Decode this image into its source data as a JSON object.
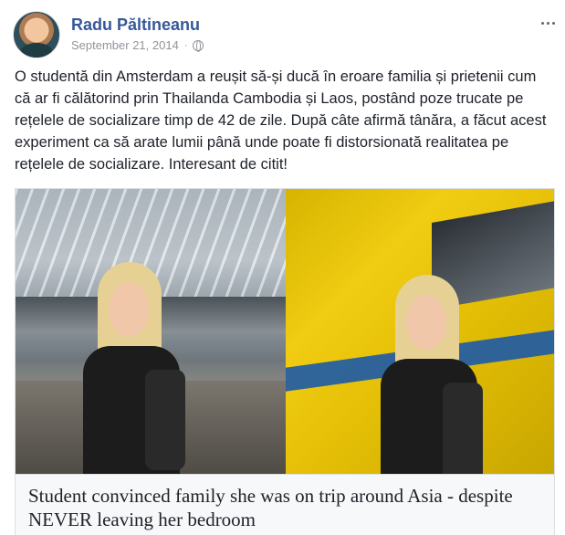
{
  "post": {
    "author": "Radu Păltineanu",
    "date": "September 21, 2014",
    "separator": "·",
    "privacy_icon": "globe-icon",
    "more_icon": "more-horizontal-icon",
    "text": "O studentă din Amsterdam a reușit să-și ducă în eroare familia și prietenii cum că ar fi călătorind prin Thailanda Cambodia și Laos, postând poze trucate pe rețelele de socializare timp de 42 de zile. După câte afirmă tânăra, a făcut acest experiment ca să arate lumii până unde poate fi distorsionată realitatea pe rețelele de socializare. Interesant de citit!"
  },
  "link_card": {
    "headline": "Student convinced family she was on trip around Asia - despite NEVER leaving her bedroom"
  },
  "colors": {
    "name_link": "#365899",
    "meta_text": "#90949c",
    "body_text": "#1d2129",
    "caption_bg": "#f7f8f9"
  }
}
